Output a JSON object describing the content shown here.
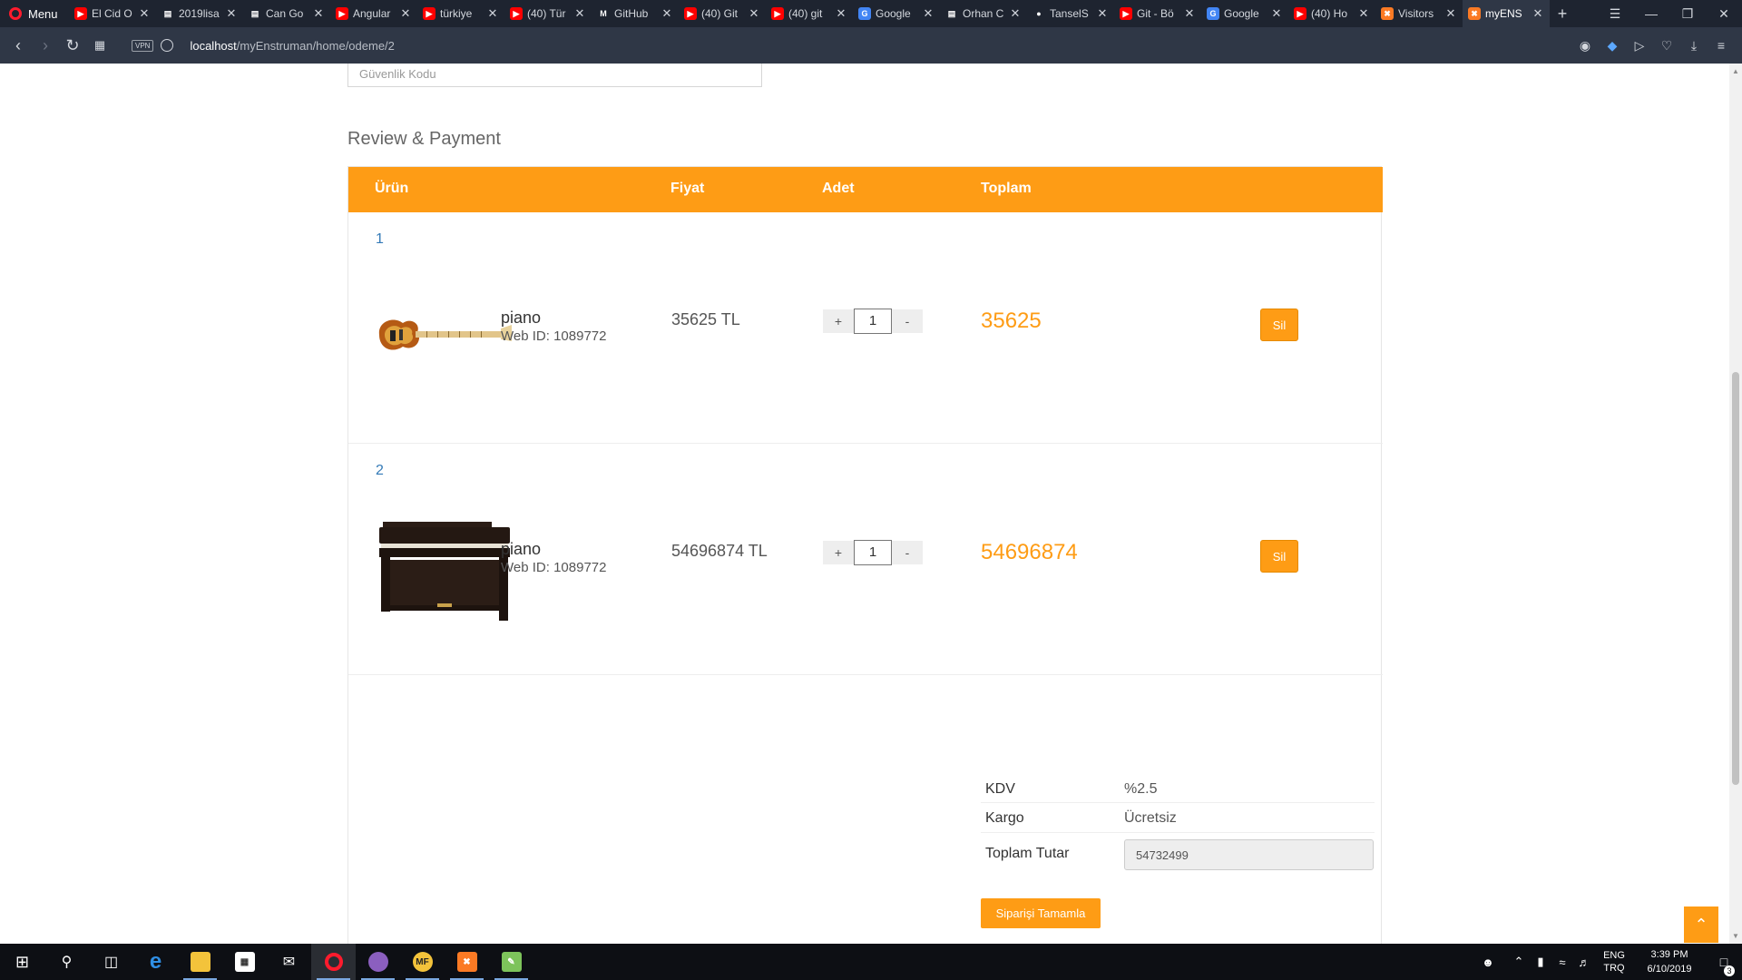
{
  "browser": {
    "menu_label": "Menu",
    "tabs": [
      {
        "title": "El Cid O",
        "favicon": "youtube-icon",
        "color": "#ff0000"
      },
      {
        "title": "2019lisa",
        "favicon": "document-icon",
        "color": "#ffffff"
      },
      {
        "title": "Can Go",
        "favicon": "document-icon",
        "color": "#ffffff"
      },
      {
        "title": "Angular",
        "favicon": "youtube-icon",
        "color": "#ff0000"
      },
      {
        "title": "türkiye",
        "favicon": "youtube-icon",
        "color": "#ff0000"
      },
      {
        "title": "(40) Tür",
        "favicon": "youtube-icon",
        "color": "#ff0000"
      },
      {
        "title": "GitHub",
        "favicon": "medium-icon",
        "color": "#ffffff"
      },
      {
        "title": "(40) Git",
        "favicon": "youtube-icon",
        "color": "#ff0000"
      },
      {
        "title": "(40) git",
        "favicon": "youtube-icon",
        "color": "#ff0000"
      },
      {
        "title": "Google",
        "favicon": "google-translate-icon",
        "color": "#4285f4"
      },
      {
        "title": "Orhan C",
        "favicon": "document-icon",
        "color": "#ffffff"
      },
      {
        "title": "TanselS",
        "favicon": "github-icon",
        "color": "#ffffff"
      },
      {
        "title": "Git - Bö",
        "favicon": "youtube-icon",
        "color": "#ff0000"
      },
      {
        "title": "Google",
        "favicon": "google-translate-icon",
        "color": "#4285f4"
      },
      {
        "title": "(40) Ho",
        "favicon": "youtube-icon",
        "color": "#ff0000"
      },
      {
        "title": "Visitors",
        "favicon": "xampp-icon",
        "color": "#fb7a24"
      },
      {
        "title": "myENS",
        "favicon": "xampp-icon",
        "color": "#fb7a24",
        "active": true
      }
    ],
    "url_host": "localhost",
    "url_path": "/myEnstruman/home/odeme/2",
    "vpn_label": "VPN"
  },
  "page": {
    "security_placeholder": "Güvenlik Kodu",
    "section_title": "Review & Payment",
    "columns": {
      "product": "Ürün",
      "price": "Fiyat",
      "quantity": "Adet",
      "total": "Toplam"
    },
    "items": [
      {
        "number": "1",
        "name": "piano",
        "web_id": "Web ID: 1089772",
        "price": "35625 TL",
        "quantity": "1",
        "total": "35625",
        "delete_label": "Sil",
        "image": "bass-guitar"
      },
      {
        "number": "2",
        "name": "piano",
        "web_id": "Web ID: 1089772",
        "price": "54696874 TL",
        "quantity": "1",
        "total": "54696874",
        "delete_label": "Sil",
        "image": "digital-piano"
      }
    ],
    "qty_plus": "+",
    "qty_minus": "-",
    "summary": {
      "kdv_label": "KDV",
      "kdv_value": "%2.5",
      "shipping_label": "Kargo",
      "shipping_value": "Ücretsiz",
      "total_label": "Toplam Tutar",
      "total_value": "54732499"
    },
    "complete_button": "Siparişi Tamamla",
    "accent_color": "#fe9c15"
  },
  "taskbar": {
    "apps": [
      "windows-start-icon",
      "search-icon",
      "task-view-icon",
      "edge-icon",
      "file-explorer-icon",
      "store-icon",
      "mail-icon",
      "opera-icon",
      "tor-icon",
      "mf-icon",
      "xampp-icon",
      "notepad-icon"
    ],
    "lang_top": "ENG",
    "lang_bottom": "TRQ",
    "time": "3:39 PM",
    "date": "6/10/2019",
    "notification_count": "3"
  }
}
